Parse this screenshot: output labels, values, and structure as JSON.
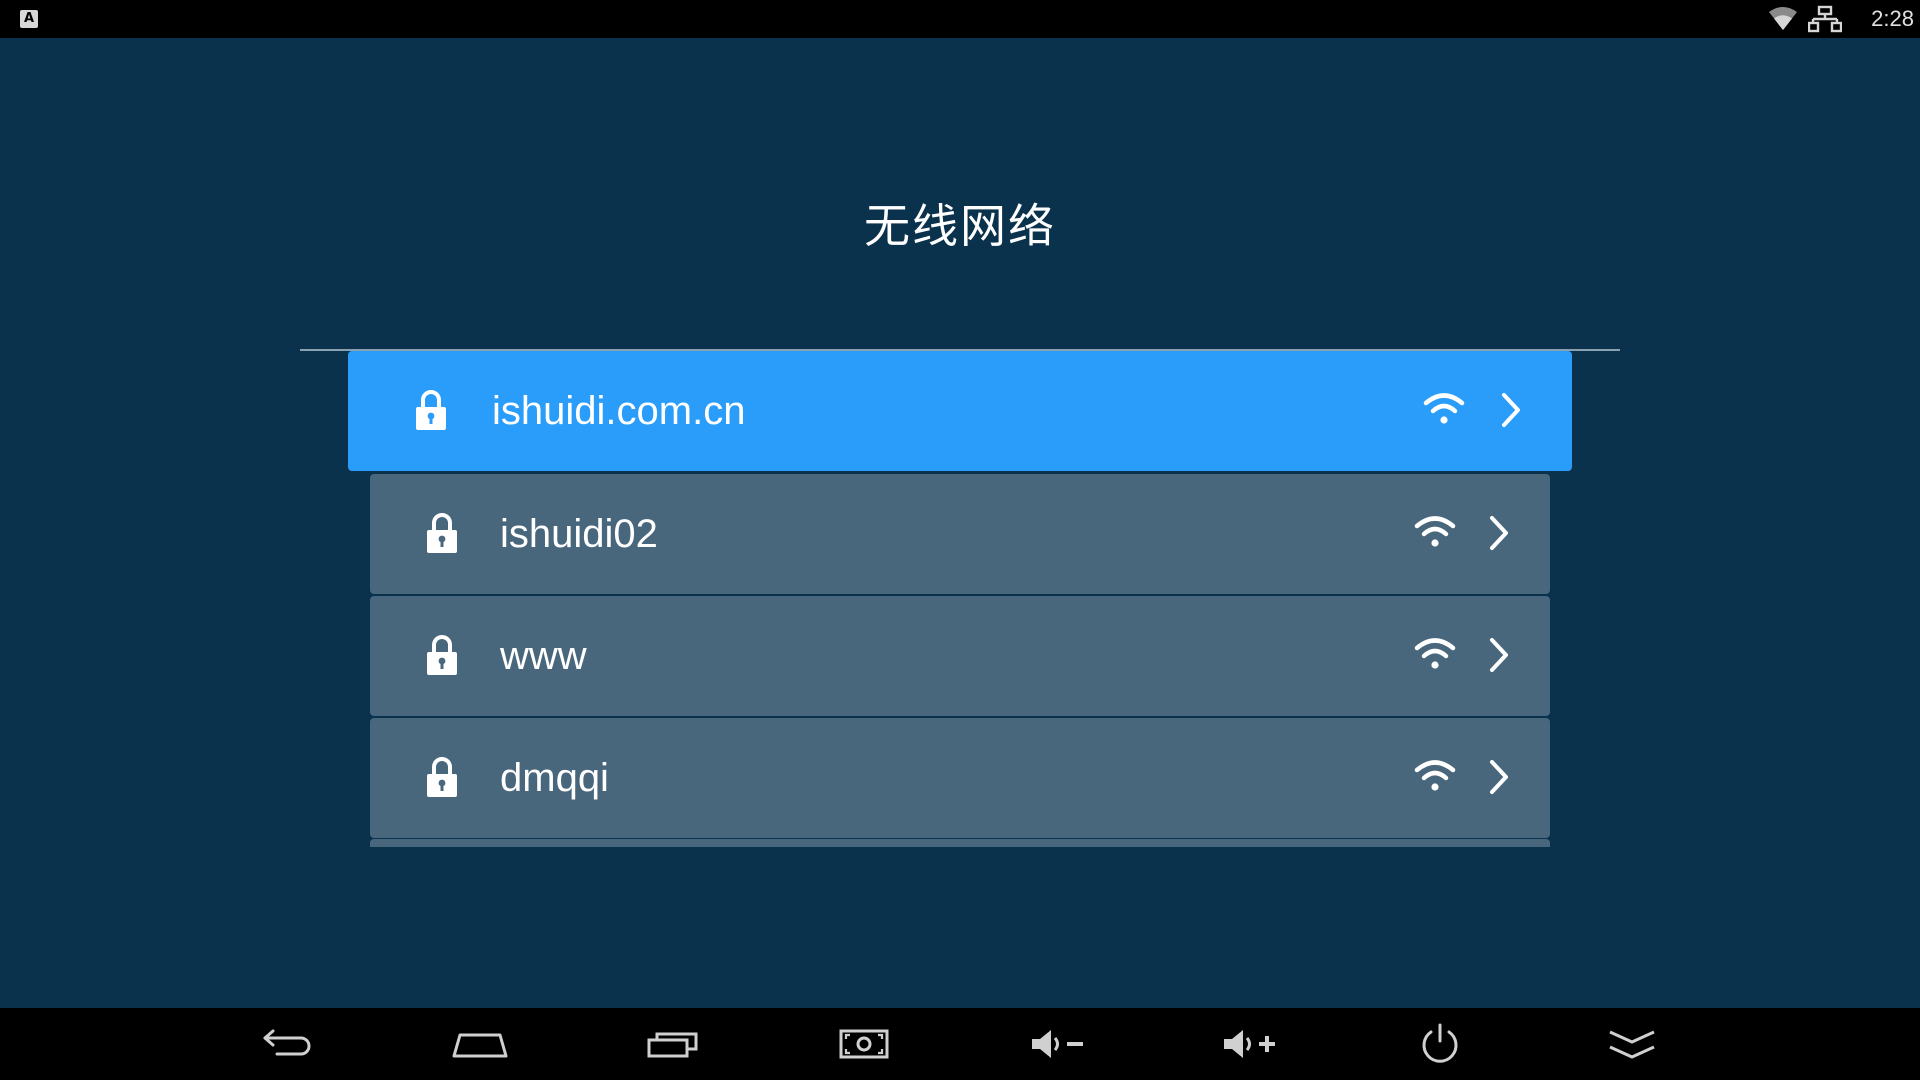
{
  "status_bar": {
    "notification_icon": "A",
    "wifi_icon": "wifi-icon",
    "ethernet_icon": "ethernet-icon",
    "time": "2:28"
  },
  "page": {
    "title": "无线网络"
  },
  "networks": [
    {
      "ssid": "ishuidi.com.cn",
      "secured": true,
      "selected": true
    },
    {
      "ssid": "ishuidi02",
      "secured": true,
      "selected": false
    },
    {
      "ssid": "www",
      "secured": true,
      "selected": false
    },
    {
      "ssid": "dmqqi",
      "secured": true,
      "selected": false
    }
  ],
  "nav_bar": {
    "buttons": [
      "back-icon",
      "home-icon",
      "recent-apps-icon",
      "screenshot-icon",
      "volume-down-icon",
      "volume-up-icon",
      "power-icon",
      "hide-bar-icon"
    ]
  },
  "colors": {
    "background": "#0b324d",
    "item": "#49677c",
    "selected_item": "#2a9dfb",
    "bars": "#000000"
  }
}
